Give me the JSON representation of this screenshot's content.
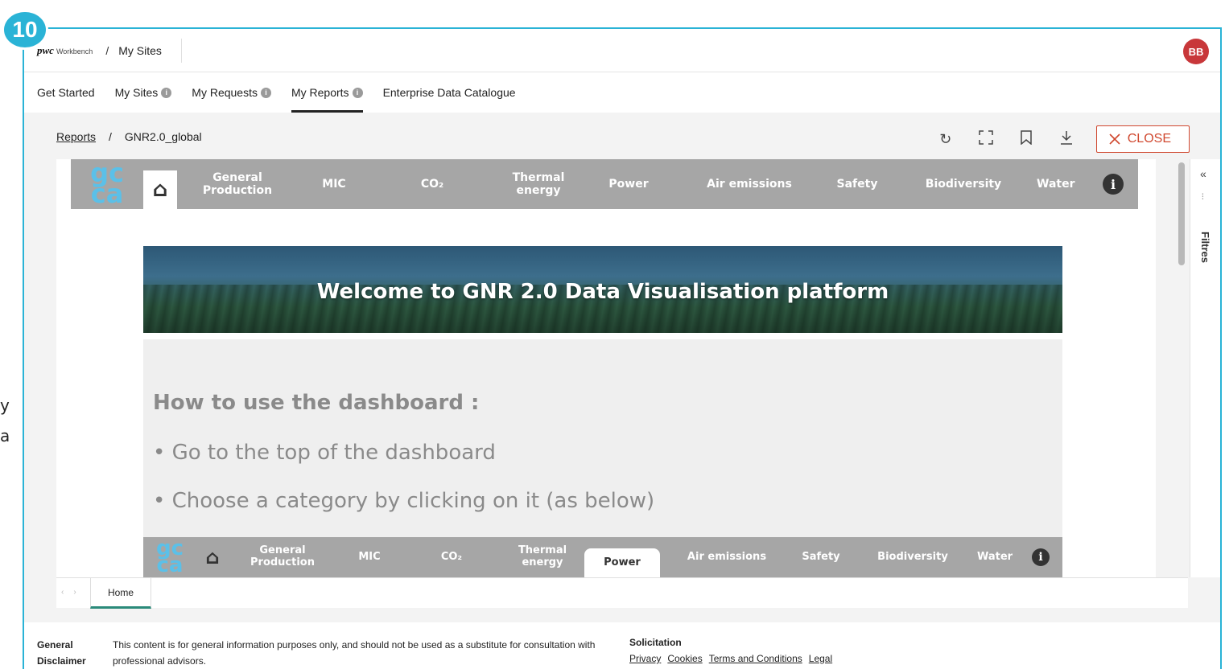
{
  "step_number": "10",
  "left_fragments": [
    "y",
    "a"
  ],
  "topbar": {
    "brand_logo": "pwc",
    "brand_sub": "Workbench",
    "separator": "/",
    "site": "My Sites",
    "avatar": "BB"
  },
  "nav_tabs": [
    {
      "label": "Get Started",
      "info": false
    },
    {
      "label": "My Sites",
      "info": true
    },
    {
      "label": "My Requests",
      "info": true
    },
    {
      "label": "My Reports",
      "info": true,
      "active": true
    },
    {
      "label": "Enterprise Data Catalogue",
      "info": false
    }
  ],
  "report_crumbs": {
    "root": "Reports",
    "separator": "/",
    "current": "GNR2.0_global"
  },
  "toolbar": {
    "close_label": "CLOSE"
  },
  "side_panel": {
    "label": "Filtres"
  },
  "report": {
    "logo_top": "gc",
    "logo_bottom": "ca",
    "nav_items": [
      "General Production",
      "MIC",
      "CO₂",
      "Thermal energy",
      "Power",
      "Air emissions",
      "Safety",
      "Biodiversity",
      "Water"
    ],
    "hero_title": "Welcome to GNR 2.0 Data Visualisation platform",
    "howto_title": "How to use the dashboard :",
    "howto_steps": [
      "• Go to the top of the dashboard",
      "• Choose a category by clicking on it (as below)"
    ]
  },
  "page_tabs": {
    "home": "Home"
  },
  "footer": {
    "disclaimer_title": "General Disclaimer",
    "disclaimer_text": "This content is for general information purposes only, and should not be used as a substitute for consultation with professional advisors.",
    "solicitation_title": "Solicitation",
    "links": [
      "Privacy",
      "Cookies",
      "Terms and Conditions",
      "Legal"
    ]
  }
}
